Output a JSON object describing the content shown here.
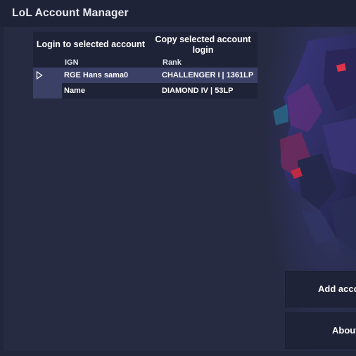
{
  "window": {
    "title": "LoL Account Manager"
  },
  "grid": {
    "actions": {
      "login_label": "Login to selected account",
      "copy_label": "Copy selected account login"
    },
    "columns": {
      "ign": "IGN",
      "rank": "Rank"
    },
    "rows": [
      {
        "ign": "RGE Hans sama0",
        "rank": "CHALLENGER I | 1361LP",
        "selected": true
      },
      {
        "ign": "Name",
        "rank": "DIAMOND IV | 53LP",
        "selected": false
      }
    ]
  },
  "side": {
    "add_label": "Add acco",
    "about_label": "About"
  },
  "icons": {
    "row_indicator": "triangle-right-icon"
  },
  "colors": {
    "background": "#262b42",
    "panel": "#1f2337",
    "selection": "#3a4066",
    "text": "#ffffff"
  }
}
